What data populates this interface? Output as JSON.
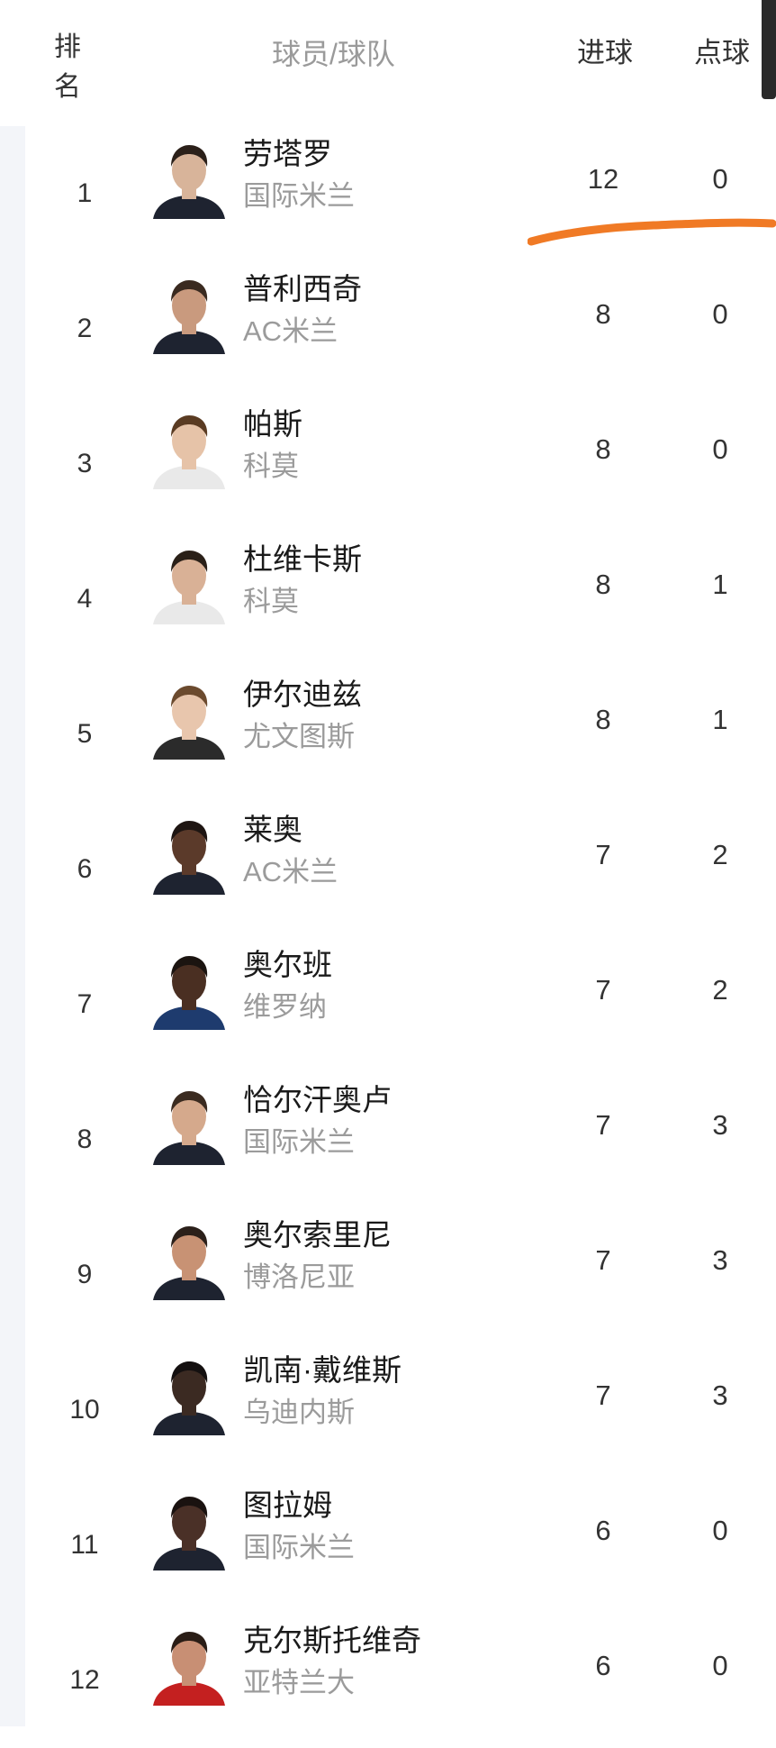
{
  "header": {
    "rank": "排名",
    "player_team": "球员/球队",
    "goals": "进球",
    "penalties": "点球"
  },
  "colors": {
    "annotation_underline": "#f07a25",
    "header_text": "#9a9a9a",
    "name_text": "#1a1a1a",
    "team_text": "#9b9b9b"
  },
  "rows": [
    {
      "rank": "1",
      "name": "劳塔罗",
      "team": "国际米兰",
      "goals": "12",
      "penalties": "0"
    },
    {
      "rank": "2",
      "name": "普利西奇",
      "team": "AC米兰",
      "goals": "8",
      "penalties": "0"
    },
    {
      "rank": "3",
      "name": "帕斯",
      "team": "科莫",
      "goals": "8",
      "penalties": "0"
    },
    {
      "rank": "4",
      "name": "杜维卡斯",
      "team": "科莫",
      "goals": "8",
      "penalties": "1"
    },
    {
      "rank": "5",
      "name": "伊尔迪兹",
      "team": "尤文图斯",
      "goals": "8",
      "penalties": "1"
    },
    {
      "rank": "6",
      "name": "莱奥",
      "team": "AC米兰",
      "goals": "7",
      "penalties": "2"
    },
    {
      "rank": "7",
      "name": "奥尔班",
      "team": "维罗纳",
      "goals": "7",
      "penalties": "2"
    },
    {
      "rank": "8",
      "name": "恰尔汗奥卢",
      "team": "国际米兰",
      "goals": "7",
      "penalties": "3"
    },
    {
      "rank": "9",
      "name": "奥尔索里尼",
      "team": "博洛尼亚",
      "goals": "7",
      "penalties": "3"
    },
    {
      "rank": "10",
      "name": "凯南·戴维斯",
      "team": "乌迪内斯",
      "goals": "7",
      "penalties": "3"
    },
    {
      "rank": "11",
      "name": "图拉姆",
      "team": "国际米兰",
      "goals": "6",
      "penalties": "0"
    },
    {
      "rank": "12",
      "name": "克尔斯托维奇",
      "team": "亚特兰大",
      "goals": "6",
      "penalties": "0"
    }
  ]
}
